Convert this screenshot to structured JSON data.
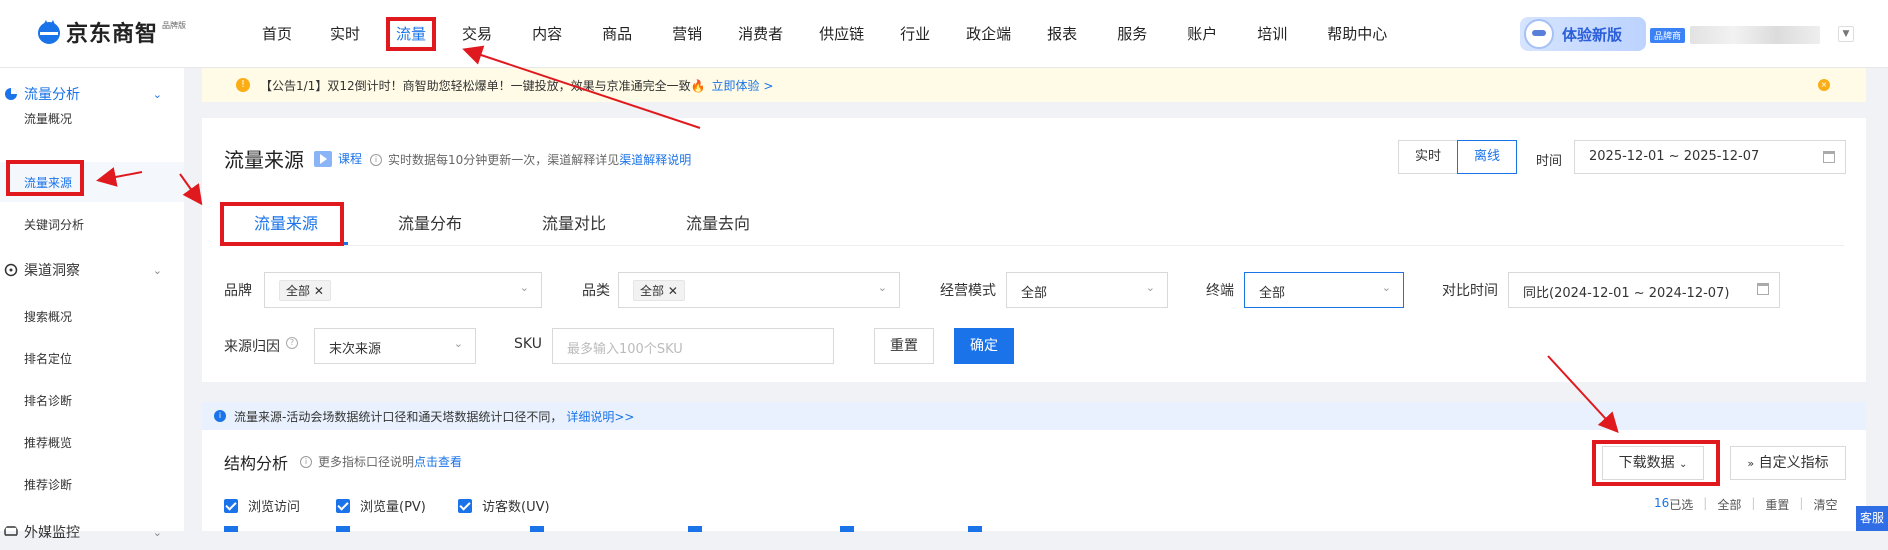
{
  "logo": {
    "text": "京东商智",
    "badge": "品牌版"
  },
  "nav": {
    "items": [
      "首页",
      "实时",
      "流量",
      "交易",
      "内容",
      "商品",
      "营销",
      "消费者",
      "供应链",
      "行业",
      "政企端",
      "报表",
      "服务",
      "账户",
      "培训",
      "帮助中心"
    ],
    "active": "流量"
  },
  "user": {
    "try_new": "体验新版",
    "role_badge": "品牌商"
  },
  "sidebar": {
    "groups": [
      {
        "label": "流量分析",
        "items": [
          "流量概况",
          "流量来源",
          "关键词分析"
        ],
        "active_item": "流量来源"
      },
      {
        "label": "渠道洞察",
        "items": [
          "搜索概况",
          "排名定位",
          "排名诊断",
          "推荐概览",
          "推荐诊断"
        ]
      },
      {
        "label": "外媒监控"
      }
    ]
  },
  "notice": {
    "text": "【公告1/1】双12倒计时！商智助您轻松爆单！一键投放，效果与京准通完全一致🔥",
    "link": "立即体验 >",
    "warn_icon": "!",
    "close_icon": "×"
  },
  "panel": {
    "title": "流量来源",
    "course": "课程",
    "tip_text": "实时数据每10分钟更新一次，渠道解释详见",
    "tip_link": "渠道解释说明",
    "mode_realtime": "实时",
    "mode_offline": "离线",
    "time_label": "时间",
    "date_range": "2025-12-01 ~ 2025-12-07",
    "tabs": [
      "流量来源",
      "流量分布",
      "流量对比",
      "流量去向"
    ]
  },
  "filters": {
    "brand_label": "品牌",
    "brand_value": "全部",
    "category_label": "品类",
    "category_value": "全部",
    "mode_label": "经营模式",
    "mode_value": "全部",
    "terminal_label": "终端",
    "terminal_value": "全部",
    "compare_label": "对比时间",
    "compare_value": "同比(2024-12-01 ~ 2024-12-07)",
    "attribution_label": "来源归因",
    "attribution_value": "末次来源",
    "sku_label": "SKU",
    "sku_placeholder": "最多输入100个SKU",
    "reset": "重置",
    "confirm": "确定"
  },
  "info_strip": {
    "icon": "i",
    "text": "流量来源-活动会场数据统计口径和通天塔数据统计口径不同，",
    "link": "详细说明>>"
  },
  "structure": {
    "title": "结构分析",
    "tip_text": "更多指标口径说明",
    "tip_link": "点击查看",
    "download": "下载数据",
    "customize": "自定义指标",
    "checks": [
      "浏览访问",
      "浏览量(PV)",
      "访客数(UV)"
    ],
    "selected_count": "16",
    "selected_suffix": "已选",
    "all": "全部",
    "reset": "重置",
    "clear": "清空"
  },
  "kefu": "客服",
  "colors": {
    "accent": "#1a73e8",
    "annotation_red": "#e0191e"
  }
}
